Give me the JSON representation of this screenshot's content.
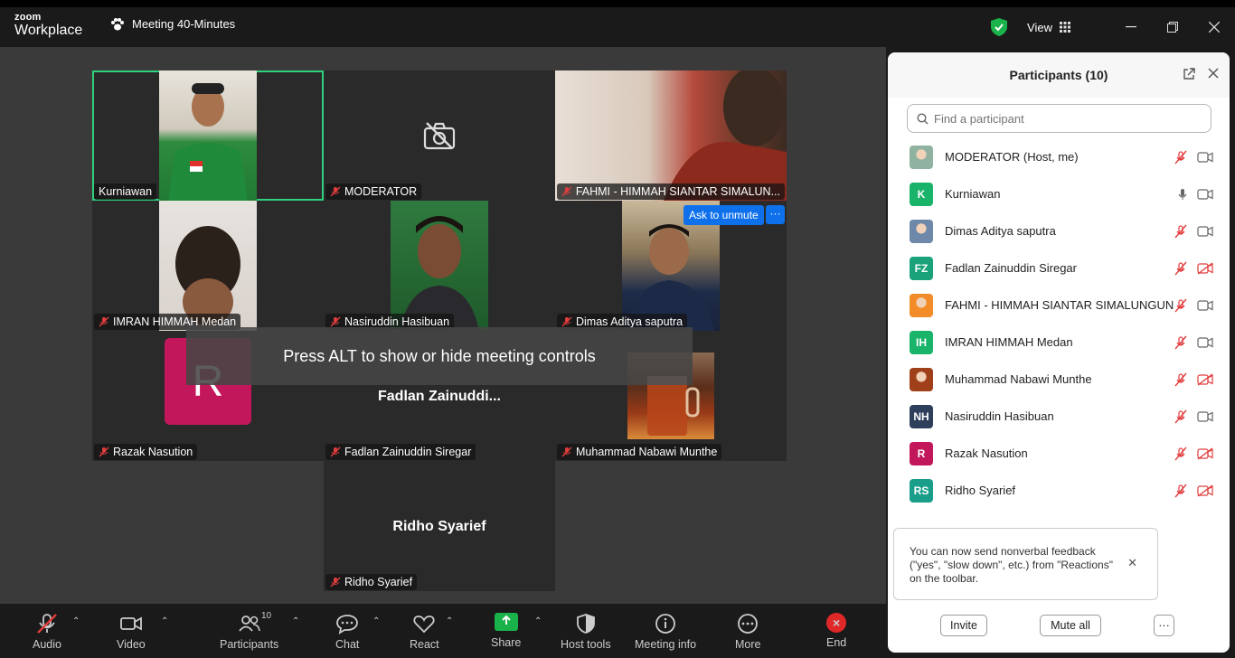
{
  "app": {
    "logo_line1": "zoom",
    "logo_line2": "Workplace",
    "meeting_title": "Meeting 40-Minutes",
    "view_label": "View",
    "security_color": "#1ab34b"
  },
  "stage": {
    "tiles": [
      {
        "name": "Kurniawan",
        "muted": false,
        "type": "video",
        "active": true
      },
      {
        "name": "MODERATOR",
        "muted": true,
        "type": "camera-off"
      },
      {
        "name": "FAHMI - HIMMAH SIANTAR SIMALUN...",
        "muted": true,
        "type": "video"
      },
      {
        "name": "IMRAN HIMMAH Medan",
        "muted": true,
        "type": "video"
      },
      {
        "name": "Nasiruddin Hasibuan",
        "muted": true,
        "type": "video"
      },
      {
        "name": "Dimas Aditya saputra",
        "muted": true,
        "type": "video"
      },
      {
        "name": "Razak Nasution",
        "muted": true,
        "type": "avatar",
        "avatar_letter": "R"
      },
      {
        "name": "Fadlan Zainuddin Siregar",
        "muted": true,
        "type": "name-only",
        "display_name": "Fadlan  Zainuddi..."
      },
      {
        "name": "Muhammad Nabawi Munthe",
        "muted": true,
        "type": "video"
      },
      {
        "name": "Ridho Syarief",
        "muted": true,
        "type": "name-only",
        "display_name": "Ridho Syarief"
      }
    ],
    "ask_to_unmute": "Ask to unmute",
    "more_label": "···",
    "alt_banner": "Press ALT to show or hide meeting controls"
  },
  "toolbar": {
    "audio": "Audio",
    "video": "Video",
    "participants": "Participants",
    "participants_count": "10",
    "chat": "Chat",
    "react": "React",
    "share": "Share",
    "host_tools": "Host tools",
    "meeting_info": "Meeting info",
    "more": "More",
    "end": "End"
  },
  "panel": {
    "title": "Participants (10)",
    "search_placeholder": "Find a participant",
    "participants": [
      {
        "name": "MODERATOR (Host, me)",
        "avatar": "img",
        "color": "#8fb3a0",
        "mic": "muted",
        "cam": "on"
      },
      {
        "name": "Kurniawan",
        "avatar": "K",
        "color": "#1ab36a",
        "mic": "on",
        "cam": "on"
      },
      {
        "name": "Dimas Aditya saputra",
        "avatar": "img",
        "color": "#6d88a8",
        "mic": "muted",
        "cam": "on"
      },
      {
        "name": "Fadlan Zainuddin Siregar",
        "avatar": "FZ",
        "color": "#1aa37a",
        "mic": "muted",
        "cam": "off"
      },
      {
        "name": "FAHMI - HIMMAH SIANTAR SIMALUNGUN",
        "avatar": "img",
        "color": "#f28c28",
        "mic": "muted",
        "cam": "on"
      },
      {
        "name": "IMRAN HIMMAH Medan",
        "avatar": "IH",
        "color": "#1ab36a",
        "mic": "muted",
        "cam": "on"
      },
      {
        "name": "Muhammad Nabawi Munthe",
        "avatar": "img",
        "color": "#a0401a",
        "mic": "muted",
        "cam": "off"
      },
      {
        "name": "Nasiruddin Hasibuan",
        "avatar": "NH",
        "color": "#2e3f5c",
        "mic": "muted",
        "cam": "on"
      },
      {
        "name": "Razak Nasution",
        "avatar": "R",
        "color": "#c2185b",
        "mic": "muted",
        "cam": "off"
      },
      {
        "name": "Ridho Syarief",
        "avatar": "RS",
        "color": "#1a9e8a",
        "mic": "muted",
        "cam": "off"
      }
    ],
    "toast_text": "You can now send nonverbal feedback (\"yes\", \"slow down\", etc.) from \"Reactions\" on the toolbar.",
    "invite": "Invite",
    "mute_all": "Mute all",
    "more": "···"
  }
}
